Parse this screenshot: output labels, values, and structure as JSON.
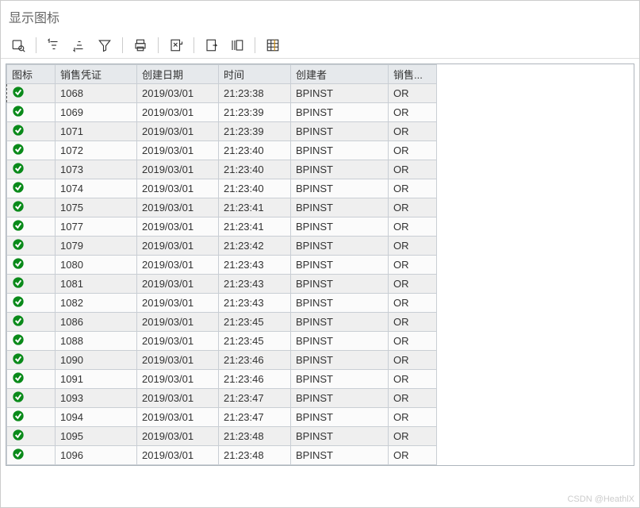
{
  "header": {
    "title": "显示图标"
  },
  "icons": {
    "status_ok": "check-circle-icon"
  },
  "table": {
    "columns": [
      "图标",
      "销售凭证",
      "创建日期",
      "时间",
      "创建者",
      "销售..."
    ],
    "rows": [
      {
        "status": "ok",
        "doc": "1068",
        "date": "2019/03/01",
        "time": "21:23:38",
        "creator": "BPINST",
        "type": "OR",
        "selected": true
      },
      {
        "status": "ok",
        "doc": "1069",
        "date": "2019/03/01",
        "time": "21:23:39",
        "creator": "BPINST",
        "type": "OR"
      },
      {
        "status": "ok",
        "doc": "1071",
        "date": "2019/03/01",
        "time": "21:23:39",
        "creator": "BPINST",
        "type": "OR"
      },
      {
        "status": "ok",
        "doc": "1072",
        "date": "2019/03/01",
        "time": "21:23:40",
        "creator": "BPINST",
        "type": "OR"
      },
      {
        "status": "ok",
        "doc": "1073",
        "date": "2019/03/01",
        "time": "21:23:40",
        "creator": "BPINST",
        "type": "OR"
      },
      {
        "status": "ok",
        "doc": "1074",
        "date": "2019/03/01",
        "time": "21:23:40",
        "creator": "BPINST",
        "type": "OR"
      },
      {
        "status": "ok",
        "doc": "1075",
        "date": "2019/03/01",
        "time": "21:23:41",
        "creator": "BPINST",
        "type": "OR"
      },
      {
        "status": "ok",
        "doc": "1077",
        "date": "2019/03/01",
        "time": "21:23:41",
        "creator": "BPINST",
        "type": "OR"
      },
      {
        "status": "ok",
        "doc": "1079",
        "date": "2019/03/01",
        "time": "21:23:42",
        "creator": "BPINST",
        "type": "OR"
      },
      {
        "status": "ok",
        "doc": "1080",
        "date": "2019/03/01",
        "time": "21:23:43",
        "creator": "BPINST",
        "type": "OR"
      },
      {
        "status": "ok",
        "doc": "1081",
        "date": "2019/03/01",
        "time": "21:23:43",
        "creator": "BPINST",
        "type": "OR"
      },
      {
        "status": "ok",
        "doc": "1082",
        "date": "2019/03/01",
        "time": "21:23:43",
        "creator": "BPINST",
        "type": "OR"
      },
      {
        "status": "ok",
        "doc": "1086",
        "date": "2019/03/01",
        "time": "21:23:45",
        "creator": "BPINST",
        "type": "OR"
      },
      {
        "status": "ok",
        "doc": "1088",
        "date": "2019/03/01",
        "time": "21:23:45",
        "creator": "BPINST",
        "type": "OR"
      },
      {
        "status": "ok",
        "doc": "1090",
        "date": "2019/03/01",
        "time": "21:23:46",
        "creator": "BPINST",
        "type": "OR"
      },
      {
        "status": "ok",
        "doc": "1091",
        "date": "2019/03/01",
        "time": "21:23:46",
        "creator": "BPINST",
        "type": "OR"
      },
      {
        "status": "ok",
        "doc": "1093",
        "date": "2019/03/01",
        "time": "21:23:47",
        "creator": "BPINST",
        "type": "OR"
      },
      {
        "status": "ok",
        "doc": "1094",
        "date": "2019/03/01",
        "time": "21:23:47",
        "creator": "BPINST",
        "type": "OR"
      },
      {
        "status": "ok",
        "doc": "1095",
        "date": "2019/03/01",
        "time": "21:23:48",
        "creator": "BPINST",
        "type": "OR"
      },
      {
        "status": "ok",
        "doc": "1096",
        "date": "2019/03/01",
        "time": "21:23:48",
        "creator": "BPINST",
        "type": "OR"
      }
    ]
  },
  "watermark": "CSDN @HeathlX"
}
